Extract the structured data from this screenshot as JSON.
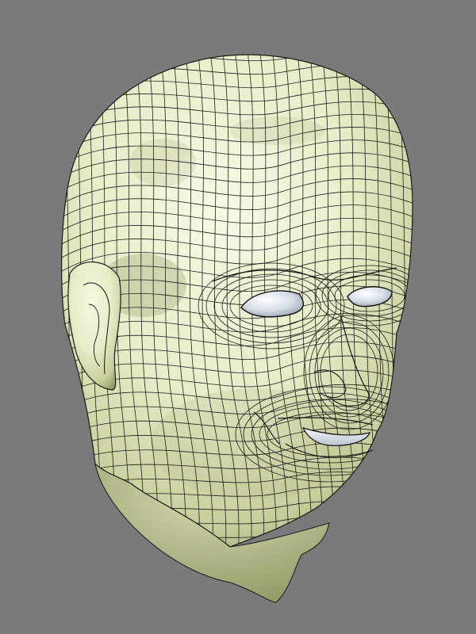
{
  "scene": {
    "subject": "wireframe-head-model",
    "background_color": "#7a7a7a",
    "skin_base_color": "#e8ecc8",
    "skin_highlight_color": "#f6f8e0",
    "skin_shadow_color": "#8e9462",
    "wire_color": "#141414",
    "eye_color": "#d6dde6",
    "teeth_color": "#dfe5ea"
  }
}
